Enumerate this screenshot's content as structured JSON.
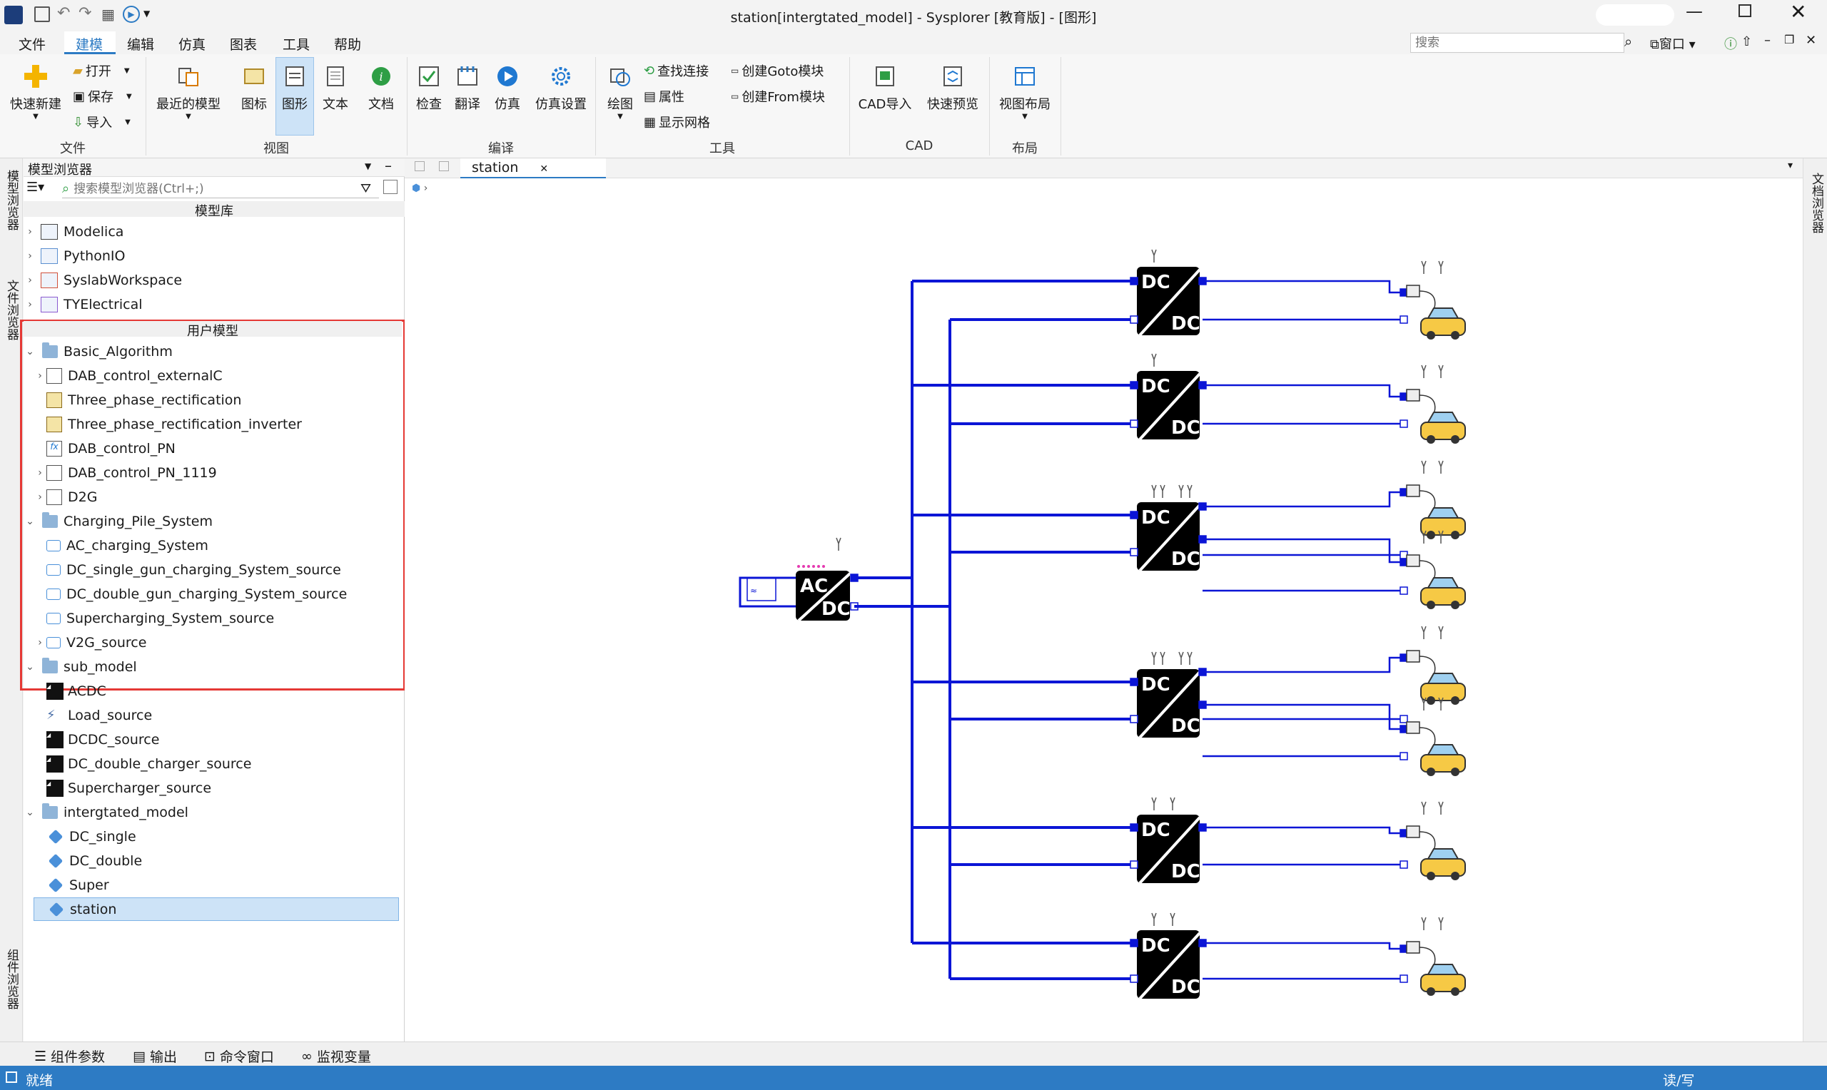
{
  "window": {
    "title": "station[intergtated_model] - Sysplorer [教育版] - [图形]"
  },
  "menu": [
    "文件",
    "建模",
    "编辑",
    "仿真",
    "图表",
    "工具",
    "帮助"
  ],
  "menu_active_index": 1,
  "search": {
    "placeholder": "搜索"
  },
  "window_menu": "窗口",
  "ribbon": {
    "file": {
      "quick_new": "快速新建",
      "open": "打开",
      "save": "保存",
      "import": "导入",
      "group": "文件"
    },
    "view": {
      "recent": "最近的模型",
      "icon": "图标",
      "diagram": "图形",
      "text": "文本",
      "doc": "文档",
      "group": "视图"
    },
    "compile": {
      "check": "检查",
      "translate": "翻译",
      "simulate": "仿真",
      "sim_settings": "仿真设置",
      "group": "编译"
    },
    "tools": {
      "draw": "绘图",
      "find_conn": "查找连接",
      "props": "属性",
      "grid": "显示网格",
      "goto": "创建Goto模块",
      "from": "创建From模块",
      "group": "工具"
    },
    "cad": {
      "import": "CAD导入",
      "preview": "快速预览",
      "group": "CAD"
    },
    "layout": {
      "view_layout": "视图布局",
      "group": "布局"
    }
  },
  "left_tabs": [
    "模型浏览器",
    "文件浏览器",
    "组件浏览器"
  ],
  "right_tabs": [
    "文档浏览器"
  ],
  "browser": {
    "title": "模型浏览器",
    "search_placeholder": "搜索模型浏览器(Ctrl+;)",
    "lib_header": "模型库",
    "libraries": [
      "Modelica",
      "PythonIO",
      "SyslabWorkspace",
      "TYElectrical"
    ],
    "user_header": "用户模型",
    "tree": [
      {
        "label": "Basic_Algorithm",
        "level": 0,
        "kind": "folder",
        "expanded": true
      },
      {
        "label": "DAB_control_externalC",
        "level": 1,
        "kind": "box",
        "arrow": true
      },
      {
        "label": "Three_phase_rectification",
        "level": 1,
        "kind": "chip"
      },
      {
        "label": "Three_phase_rectification_inverter",
        "level": 1,
        "kind": "chip"
      },
      {
        "label": "DAB_control_PN",
        "level": 1,
        "kind": "fx"
      },
      {
        "label": "DAB_control_PN_1119",
        "level": 1,
        "kind": "box",
        "arrow": true
      },
      {
        "label": "D2G",
        "level": 1,
        "kind": "box",
        "arrow": true
      },
      {
        "label": "Charging_Pile_System",
        "level": 0,
        "kind": "folder",
        "expanded": true
      },
      {
        "label": "AC_charging_System",
        "level": 1,
        "kind": "sys"
      },
      {
        "label": "DC_single_gun_charging_System_source",
        "level": 1,
        "kind": "sys"
      },
      {
        "label": "DC_double_gun_charging_System_source",
        "level": 1,
        "kind": "sys"
      },
      {
        "label": "Supercharging_System_source",
        "level": 1,
        "kind": "sys"
      },
      {
        "label": "V2G_source",
        "level": 1,
        "kind": "sys",
        "arrow": true
      },
      {
        "label": "sub_model",
        "level": 0,
        "kind": "folder",
        "expanded": true
      },
      {
        "label": "ACDC",
        "level": 1,
        "kind": "blk"
      },
      {
        "label": "Load_source",
        "level": 1,
        "kind": "load"
      },
      {
        "label": "DCDC_source",
        "level": 1,
        "kind": "blk"
      },
      {
        "label": "DC_double_charger_source",
        "level": 1,
        "kind": "blk"
      },
      {
        "label": "Supercharger_source",
        "level": 1,
        "kind": "blk"
      },
      {
        "label": "intergtated_model",
        "level": 0,
        "kind": "folder",
        "expanded": true
      },
      {
        "label": "DC_single",
        "level": 1,
        "kind": "cube"
      },
      {
        "label": "DC_double",
        "level": 1,
        "kind": "cube"
      },
      {
        "label": "Super",
        "level": 1,
        "kind": "cube"
      },
      {
        "label": "station",
        "level": 1,
        "kind": "cube",
        "selected": true
      }
    ]
  },
  "editor_tab": "station",
  "diagram": {
    "ac_label": "AC",
    "dc_label": "DC"
  },
  "bottom_tabs": [
    "组件参数",
    "输出",
    "命令窗口",
    "监视变量"
  ],
  "status": {
    "left": "就绪",
    "right": "读/写"
  },
  "colors": {
    "accent": "#2d7bc4",
    "wire": "#0b15d6",
    "highlight_box": "#e53935",
    "selected": "#cde3f7"
  }
}
